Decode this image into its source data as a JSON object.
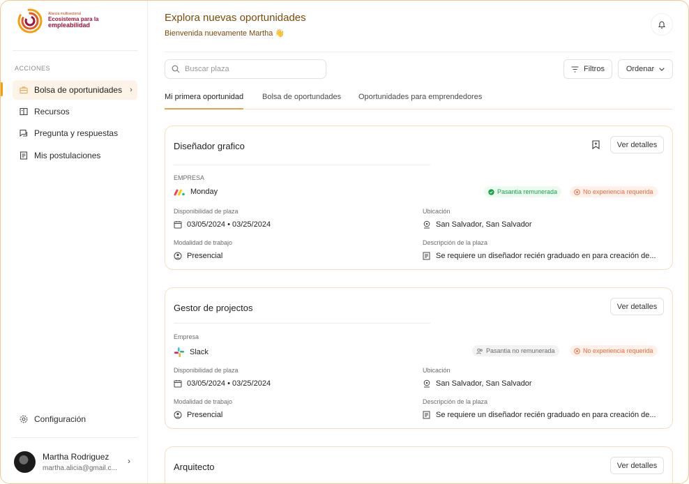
{
  "brand": {
    "line1": "Alianza multisectorial",
    "line2": "Ecosistema para la",
    "line3": "empleabilidad",
    "colors": {
      "accent": "#f59e0b",
      "brand": "#9f1239"
    }
  },
  "sidebar": {
    "section_label": "ACCIONES",
    "items": [
      {
        "label": "Bolsa de oportunidades",
        "icon": "briefcase-icon",
        "active": true
      },
      {
        "label": "Recursos",
        "icon": "book-icon"
      },
      {
        "label": "Pregunta y respuestas",
        "icon": "chat-icon"
      },
      {
        "label": "Mis postulaciones",
        "icon": "clipboard-icon"
      }
    ],
    "settings_label": "Configuración",
    "user": {
      "name": "Martha Rodriguez",
      "email": "martha.alicia@gmail.c..."
    }
  },
  "header": {
    "title": "Explora nuevas oportunidades",
    "subtitle": "Bienvenida nuevamente Martha 👋"
  },
  "toolbar": {
    "search_placeholder": "Buscar plaza",
    "filters_label": "Filtros",
    "sort_label": "Ordenar"
  },
  "tabs": [
    {
      "label": "Mi primera oportunidad",
      "active": true
    },
    {
      "label": "Bolsa de oportundades"
    },
    {
      "label": "Oportunidades para emprendedores"
    }
  ],
  "cards": [
    {
      "title": "Diseñador grafico",
      "details_label": "Ver detalles",
      "company_label": "EMPRESA",
      "company": "Monday",
      "badges": [
        {
          "text": "Pasantia remunerada",
          "type": "green"
        },
        {
          "text": "No experiencia requerida",
          "type": "red"
        }
      ],
      "availability_label": "Disponibilidad de plaza",
      "availability": "03/05/2024 • 03/25/2024",
      "location_label": "Ubicación",
      "location": "San Salvador, San Salvador",
      "modality_label": "Modalidad de trabajo",
      "modality": "Presencial",
      "description_label": "Descripción de la plaza",
      "description": "Se requiere un diseñador recién graduado en para creación de..."
    },
    {
      "title": "Gestor de projectos",
      "details_label": "Ver detalles",
      "company_label": "Empresa",
      "company": "Slack",
      "badges": [
        {
          "text": "Pasantia no remunerada",
          "type": "gray"
        },
        {
          "text": "No experiencia requerida",
          "type": "red"
        }
      ],
      "availability_label": "Disponibilidad de plaza",
      "availability": "03/05/2024 • 03/25/2024",
      "location_label": "Ubicación",
      "location": "San Salvador, San Salvador",
      "modality_label": "Modalidad de trabajo",
      "modality": "Presencial",
      "description_label": "Descripción de la plaza",
      "description": "Se requiere un diseñador recién graduado en para creación de..."
    },
    {
      "title": "Arquitecto",
      "details_label": "Ver detalles"
    }
  ]
}
